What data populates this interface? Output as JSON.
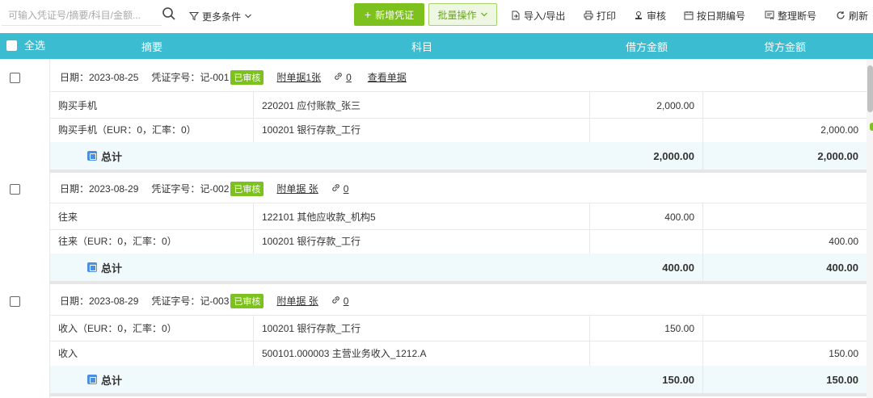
{
  "toolbar": {
    "search_placeholder": "可输入凭证号/摘要/科目/金额...",
    "more_filters": "更多条件",
    "add_voucher": "新增凭证",
    "batch_ops": "批量操作",
    "import_export": "导入/导出",
    "print": "打印",
    "review": "审核",
    "number_by_date": "按日期编号",
    "reorder_numbers": "整理断号",
    "refresh": "刷新"
  },
  "table": {
    "select_all": "全选",
    "columns": {
      "summary": "摘要",
      "subject": "科目",
      "debit": "借方金额",
      "credit": "贷方金额"
    }
  },
  "vouchers": [
    {
      "date_label": "日期：2023-08-25",
      "number_label": "凭证字号：记-001",
      "status": "已审核",
      "attachment": "附单据1张",
      "link_count": "0",
      "view_docs": "查看单据",
      "rows": [
        {
          "summary": "购买手机",
          "subject": "220201 应付账款_张三",
          "debit": "2,000.00",
          "credit": ""
        },
        {
          "summary": "购买手机（EUR：0，汇率：0）",
          "subject": "100201 银行存款_工行",
          "debit": "",
          "credit": "2,000.00"
        }
      ],
      "total_label": "总计",
      "total_debit": "2,000.00",
      "total_credit": "2,000.00"
    },
    {
      "date_label": "日期：2023-08-29",
      "number_label": "凭证字号：记-002",
      "status": "已审核",
      "attachment": "附单据 张",
      "link_count": "0",
      "rows": [
        {
          "summary": "往来",
          "subject": "122101 其他应收款_机构5",
          "debit": "400.00",
          "credit": ""
        },
        {
          "summary": "往来（EUR：0，汇率：0）",
          "subject": "100201 银行存款_工行",
          "debit": "",
          "credit": "400.00"
        }
      ],
      "total_label": "总计",
      "total_debit": "400.00",
      "total_credit": "400.00"
    },
    {
      "date_label": "日期：2023-08-29",
      "number_label": "凭证字号：记-003",
      "status": "已审核",
      "attachment": "附单据 张",
      "link_count": "0",
      "rows": [
        {
          "summary": "收入（EUR：0，汇率：0）",
          "subject": "100201 银行存款_工行",
          "debit": "150.00",
          "credit": ""
        },
        {
          "summary": "收入",
          "subject": "500101.000003  主营业务收入_1212.A",
          "debit": "",
          "credit": "150.00"
        }
      ],
      "total_label": "总计",
      "total_debit": "150.00",
      "total_credit": "150.00"
    }
  ],
  "colors": {
    "header": "#3bbcd0",
    "accent_green": "#7dc11e"
  }
}
